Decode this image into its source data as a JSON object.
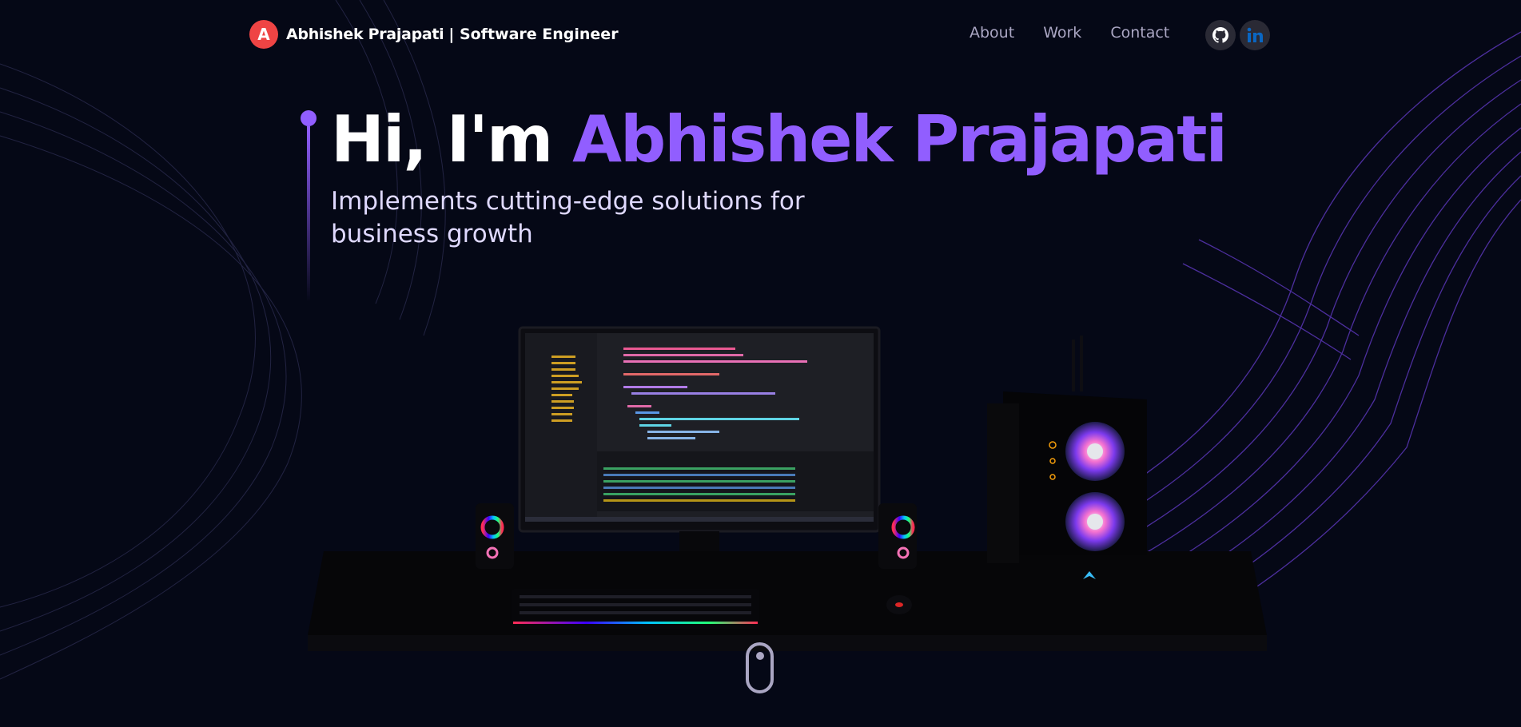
{
  "brand": {
    "name": "Abhishek Prajapati",
    "role": "| Software Engineer",
    "logo_letter": "A"
  },
  "nav": {
    "links": [
      "About",
      "Work",
      "Contact"
    ]
  },
  "social": {
    "github": "github-icon",
    "linkedin": "linkedin-icon"
  },
  "hero": {
    "greeting": "Hi, I'm",
    "name": "Abhishek Prajapati",
    "subtitle_line1": "Implements cutting-edge solutions for",
    "subtitle_line2": "business growth"
  },
  "colors": {
    "background": "#050816",
    "accent": "#915eff",
    "nav_text": "#aaa6c3",
    "logo": "#ef4444",
    "linkedin": "#0a66c2"
  }
}
